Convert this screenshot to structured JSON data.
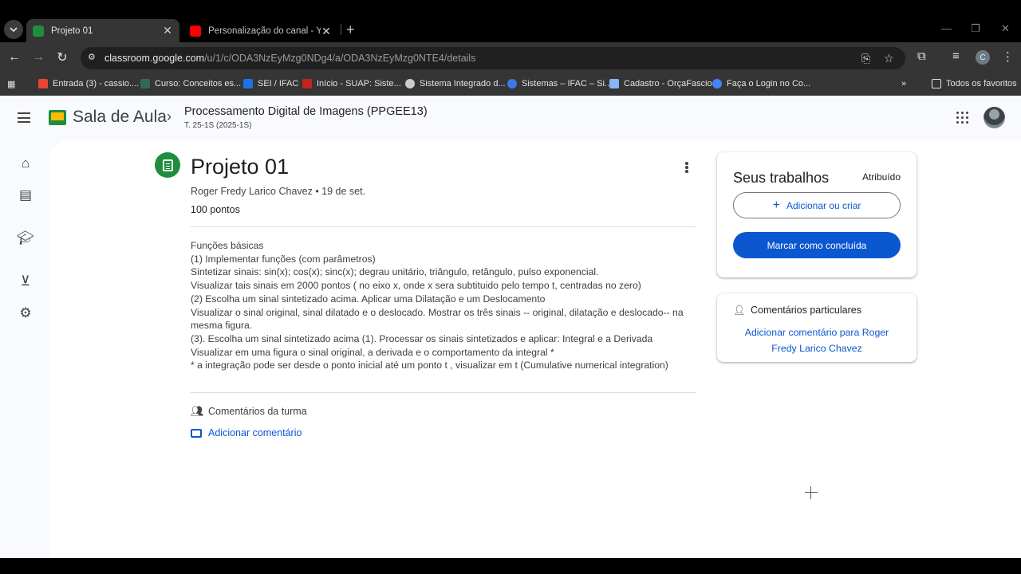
{
  "browser": {
    "tabs": [
      {
        "title": "Projeto 01",
        "active": true,
        "favicon_color": "#1e8e3e"
      },
      {
        "title": "Personalização do canal - YouTu",
        "active": false,
        "favicon_color": "#ff0000"
      }
    ],
    "url_host": "classroom.google.com",
    "url_path": "/u/1/c/ODA3NzEyMzg0NDg4/a/ODA3NzEyMzg0NTE4/details",
    "profile_initial": "C",
    "bookmarks": [
      {
        "label": "Entrada (3) - cassio....",
        "icon_color": "#ea4335"
      },
      {
        "label": "Curso: Conceitos es...",
        "icon_color": "#2f6b4f"
      },
      {
        "label": "SEI / IFAC",
        "icon_color": "#1a73e8"
      },
      {
        "label": "Início - SUAP: Siste...",
        "icon_color": "#c5221f"
      },
      {
        "label": "Sistema Integrado d...",
        "icon_color": "#cccccc"
      },
      {
        "label": "Sistemas – IFAC – Si...",
        "icon_color": "#3b78e7"
      },
      {
        "label": "Cadastro - OrçaFascio",
        "icon_color": "#8ab4f8"
      },
      {
        "label": "Faça o Login no Co...",
        "icon_color": "#4285f4"
      }
    ],
    "all_bookmarks_label": "Todos os favoritos"
  },
  "app": {
    "brand": "Sala de Aula",
    "course_title": "Processamento Digital de Imagens (PPGEE13)",
    "course_subtitle": "T. 25-1S (2025-1S)"
  },
  "assignment": {
    "title": "Projeto 01",
    "meta": "Roger Fredy Larico Chavez • 19 de set.",
    "points": "100 pontos",
    "body_lines": [
      "Funções básicas",
      "(1) Implementar funções (com parâmetros)",
      "Sintetizar sinais: sin(x); cos(x); sinc(x); degrau unitário, triângulo, retângulo, pulso exponencial.",
      "Visualizar tais sinais em 2000 pontos ( no eixo x, onde x sera subtituido pelo tempo t, centradas no zero)",
      "(2) Escolha um sinal sintetizado acima. Aplicar uma Dilatação e um Deslocamento",
      "Visualizar o sinal original, sinal dilatado e o deslocado. Mostrar os três sinais -- original, dilatação e deslocado-- na",
      "mesma figura.",
      "(3). Escolha um sinal sintetizado acima (1). Processar os sinais sintetizados e aplicar: Integral e a Derivada",
      "Visualizar em uma figura o sinal original, a derivada e o comportamento da integral *",
      "* a integração pode ser desde o ponto inicial até um ponto t ,  visualizar em t (Cumulative numerical integration)"
    ],
    "class_comments_label": "Comentários da turma",
    "add_comment_label": "Adicionar comentário"
  },
  "work_card": {
    "heading": "Seus trabalhos",
    "status": "Atribuído",
    "add_button": "Adicionar ou criar",
    "done_button": "Marcar como concluída"
  },
  "private_card": {
    "heading": "Comentários particulares",
    "link": "Adicionar comentário para Roger Fredy Larico Chavez"
  },
  "colors": {
    "accent": "#0b57d0",
    "classroom_green": "#1e8e3e"
  }
}
